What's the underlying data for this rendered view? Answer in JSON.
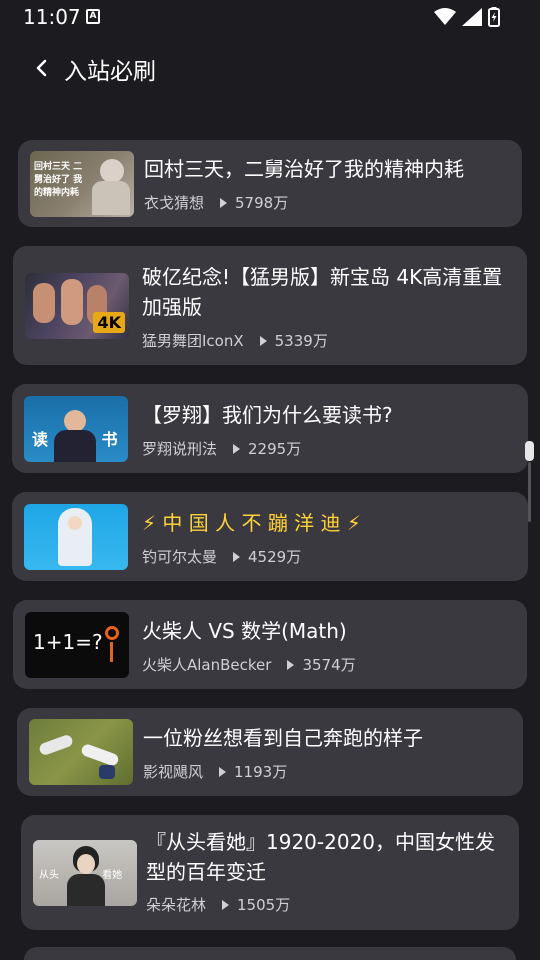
{
  "status": {
    "time": "11:07",
    "indicator": "A"
  },
  "app_bar": {
    "title": "入站必刷"
  },
  "videos": [
    {
      "title": "回村三天，二舅治好了我的精神内耗",
      "author": "衣戈猜想",
      "views": "5798万",
      "thumb_text": "回村三天 二舅治好了 我的精神内耗"
    },
    {
      "title": "破亿纪念!【猛男版】新宝岛 4K高清重置加强版",
      "author": "猛男舞团IconX",
      "views": "5339万",
      "thumb_text": "4K"
    },
    {
      "title": "【罗翔】我们为什么要读书?",
      "author": "罗翔说刑法",
      "views": "2295万",
      "thumb_text": "读 书"
    },
    {
      "title": "⚡ 中 国 人 不 蹦 洋 迪 ⚡",
      "author": "钓可尔太曼",
      "views": "4529万"
    },
    {
      "title": "火柴人 VS 数学(Math)",
      "author": "火柴人AlanBecker",
      "views": "3574万",
      "thumb_text": "1+1=?"
    },
    {
      "title": "一位粉丝想看到自己奔跑的样子",
      "author": "影视飓风",
      "views": "1193万"
    },
    {
      "title": "『从头看她』1920-2020，中国女性发型的百年变迁",
      "author": "朵朵花林",
      "views": "1505万",
      "thumb_text": "从头 看她"
    }
  ],
  "icons": {
    "back": "chevron-left-icon",
    "play": "play-icon",
    "wifi": "wifi-icon",
    "signal": "signal-icon",
    "battery": "battery-charging-icon"
  },
  "colors": {
    "background": "#1c1b1f",
    "card": "#3a3940",
    "text": "#ffffff",
    "meta": "#cfcfd4"
  }
}
